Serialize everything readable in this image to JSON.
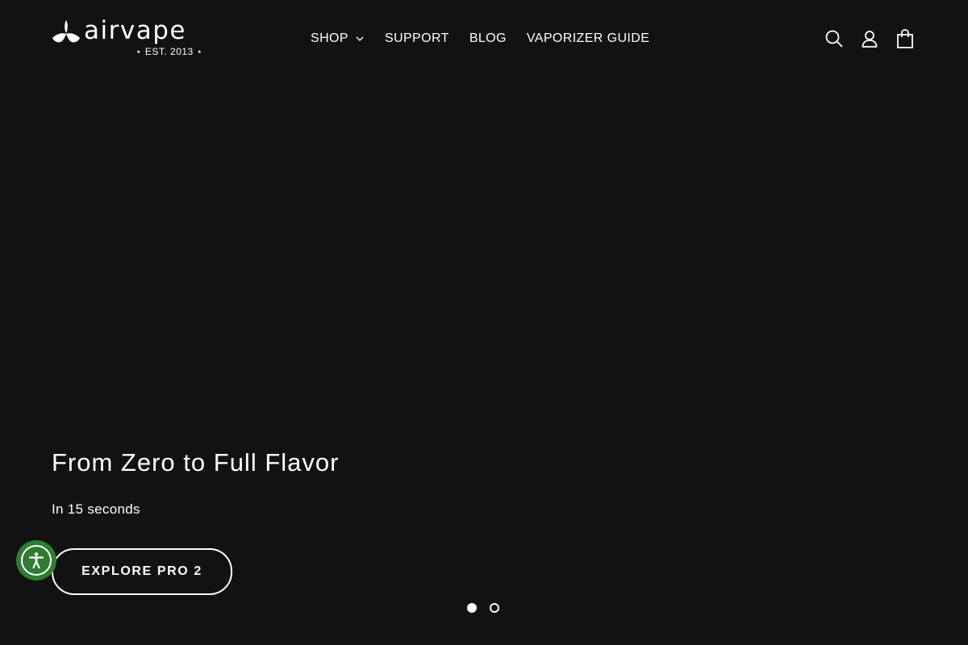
{
  "brand": {
    "name": "airvape",
    "tagline": "⋆ EST. 2013 ⋆"
  },
  "nav": {
    "items": [
      {
        "label": "SHOP",
        "has_dropdown": true
      },
      {
        "label": "SUPPORT"
      },
      {
        "label": "BLOG"
      },
      {
        "label": "VAPORIZER GUIDE"
      }
    ]
  },
  "header_icons": [
    "search-icon",
    "account-icon",
    "cart-icon"
  ],
  "hero": {
    "title": "From Zero to Full Flavor",
    "subtitle": "In 15 seconds",
    "cta_label": "EXPLORE PRO 2"
  },
  "slider": {
    "slide_count": 2,
    "active_index": 0
  },
  "colors": {
    "background": "#121212",
    "text": "#ffffff",
    "accessibility_button": "#2e7d32"
  }
}
